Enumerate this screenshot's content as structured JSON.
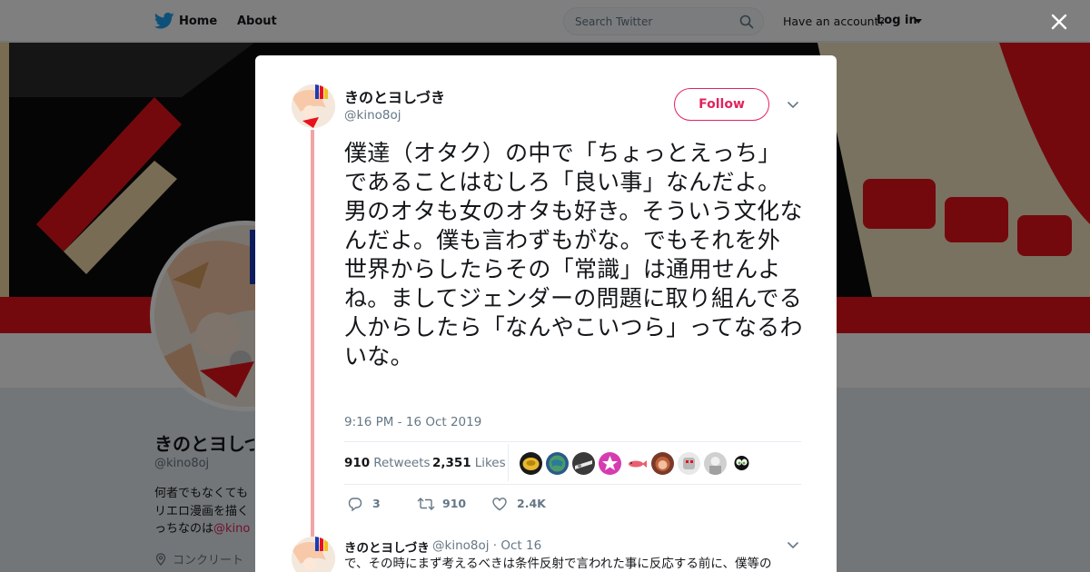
{
  "nav": {
    "home": "Home",
    "about": "About",
    "search_placeholder": "Search Twitter",
    "have_account": "Have an account?",
    "login": "Log in"
  },
  "profile": {
    "name": "きのとヨしづき",
    "handle": "@kino8oj",
    "bio_line1": "何者でもなくても",
    "bio_line2": "リエロ漫画を描く",
    "bio_line3": "っちなのは",
    "bio_link": "@kino",
    "location": "コンクリート"
  },
  "tweet": {
    "author_name": "きのとヨしづき",
    "author_handle": "@kino8oj",
    "follow_label": "Follow",
    "text": "僕達（オタク）の中で「ちょっとえっち」であることはむしろ「良い事」なんだよ。男のオタも女のオタも好き。そういう文化なんだよ。僕も言わずもがな。でもそれを外世界からしたらその「常識」は通用せんよね。ましてジェンダーの問題に取り組んでる人からしたら「なんやこいつら」ってなるわいな。",
    "timestamp": "9:16 PM - 16 Oct 2019",
    "retweets_count": "910",
    "retweets_label": "Retweets",
    "likes_count": "2,351",
    "likes_label": "Likes",
    "reply_count": "3",
    "retweet_count_short": "910",
    "like_count_short": "2.4K"
  },
  "likers": [
    {
      "color": "#e8b830",
      "icon": "gold-coin-avatar"
    },
    {
      "color": "#4a9a6a",
      "icon": "globe-avatar"
    },
    {
      "color": "#3a3a3a",
      "icon": "dark-avatar"
    },
    {
      "color": "#d63cb0",
      "icon": "star-avatar"
    },
    {
      "color": "#ffffff",
      "icon": "fish-avatar"
    },
    {
      "color": "#c0603a",
      "icon": "face-avatar"
    },
    {
      "color": "#b8b8b8",
      "icon": "robot-avatar"
    },
    {
      "color": "#d0d0d0",
      "icon": "gray-avatar"
    },
    {
      "color": "#5ab03c",
      "icon": "cartoon-avatar"
    }
  ],
  "reply": {
    "name": "きのとヨしづき",
    "handle_date": "@kino8oj · Oct 16",
    "text": "で、その時にまず考えるべきは条件反射で言われた事に反応する前に、僕等の"
  },
  "colors": {
    "accent": "#e0245e",
    "thread_line": "#f0a5a3",
    "banner_red": "#e8121a"
  }
}
